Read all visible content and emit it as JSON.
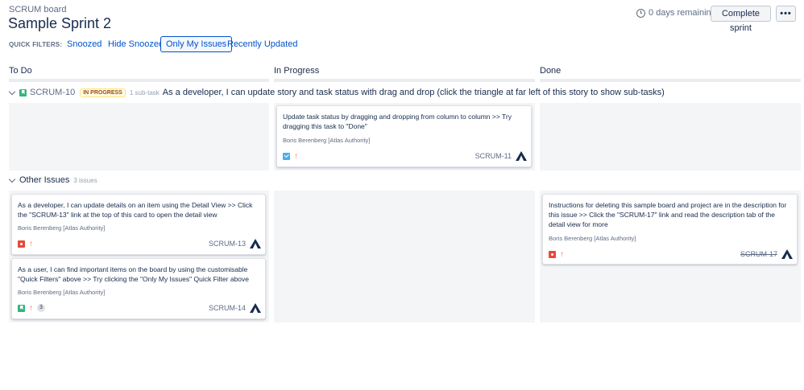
{
  "header": {
    "eyebrow": "SCRUM board",
    "title": "Sample Sprint 2",
    "remaining": "0 days remaining",
    "complete_label": "Complete sprint",
    "more_label": "•••"
  },
  "quick_filters": {
    "label": "QUICK FILTERS:",
    "items": [
      {
        "label": "Snoozed",
        "active": false
      },
      {
        "label": "Hide Snoozed",
        "active": false
      },
      {
        "label": "Only My Issues",
        "active": true
      },
      {
        "label": "Recently Updated",
        "active": false
      }
    ]
  },
  "columns": [
    "To Do",
    "In Progress",
    "Done"
  ],
  "swimlane1": {
    "key": "SCRUM-10",
    "status": "IN PROGRESS",
    "subtasks": "1 sub-task",
    "summary": "As a developer, I can update story and task status with drag and drop (click the triangle at far left of this story to show sub-tasks)"
  },
  "swimlane2": {
    "title": "Other Issues",
    "count": "3 issues"
  },
  "cards": {
    "scrum11": {
      "summary": "Update task status by dragging and dropping from column to column >> Try dragging this task to \"Done\"",
      "assignee": "Boris Berenberg [Atlas Authority]",
      "key": "SCRUM-11",
      "type": "task-icon"
    },
    "scrum13": {
      "summary": "As a developer, I can update details on an item using the Detail View >> Click the \"SCRUM-13\" link at the top of this card to open the detail view",
      "assignee": "Boris Berenberg [Atlas Authority]",
      "key": "SCRUM-13",
      "type": "bug-icon"
    },
    "scrum14": {
      "summary": "As a user, I can find important items on the board by using the customisable \"Quick Filters\" above >> Try clicking the \"Only My Issues\" Quick Filter above",
      "assignee": "Boris Berenberg [Atlas Authority]",
      "key": "SCRUM-14",
      "type": "story-icon",
      "badge": "3"
    },
    "scrum17": {
      "summary": "Instructions for deleting this sample board and project are in the description for this issue >> Click the \"SCRUM-17\" link and read the description tab of the detail view for more",
      "assignee": "Boris Berenberg [Atlas Authority]",
      "key": "SCRUM-17",
      "type": "bug-icon"
    }
  },
  "colors": {
    "accent": "#0052cc",
    "priority": "#ff7452",
    "bug": "#e5493a",
    "task": "#4bade8",
    "story": "#36b37e"
  }
}
